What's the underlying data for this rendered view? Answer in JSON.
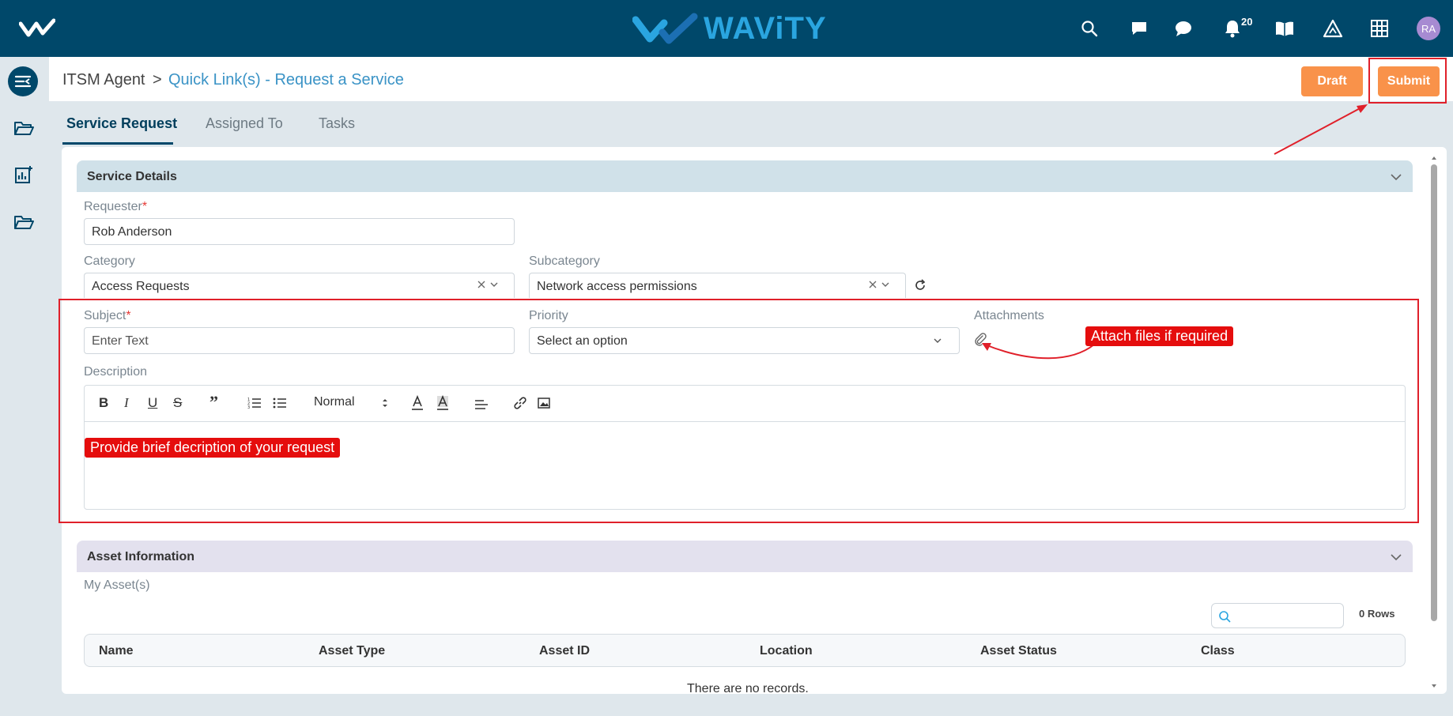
{
  "topbar": {
    "brand": "WAViTY",
    "notification_count": "20",
    "avatar_initials": "RA",
    "bg_color": "#00486a"
  },
  "breadcrumb": {
    "root": "ITSM Agent",
    "separator": ">",
    "current": "Quick Link(s) - Request a Service"
  },
  "actions": {
    "draft_label": "Draft",
    "submit_label": "Submit",
    "button_color": "#f9924a"
  },
  "tabs": [
    {
      "label": "Service Request",
      "active": true
    },
    {
      "label": "Assigned To",
      "active": false
    },
    {
      "label": "Tasks",
      "active": false
    }
  ],
  "service_details": {
    "title": "Service Details",
    "requester_label": "Requester",
    "requester_value": "Rob Anderson",
    "category_label": "Category",
    "category_value": "Access Requests",
    "subcategory_label": "Subcategory",
    "subcategory_value": "Network access permissions",
    "subject_label": "Subject",
    "subject_placeholder": "Enter Text",
    "priority_label": "Priority",
    "priority_placeholder": "Select an option",
    "attachments_label": "Attachments",
    "description_label": "Description",
    "format_value": "Normal",
    "required_mark": "*"
  },
  "annotations": {
    "attach_callout": "Attach files if required",
    "description_callout": "Provide brief decription of your request"
  },
  "asset_info": {
    "title": "Asset Information",
    "subtitle": "My Asset(s)",
    "rows_count": "0 Rows",
    "columns": [
      "Name",
      "Asset Type",
      "Asset ID",
      "Location",
      "Asset Status",
      "Class"
    ],
    "empty_message": "There are no records."
  }
}
